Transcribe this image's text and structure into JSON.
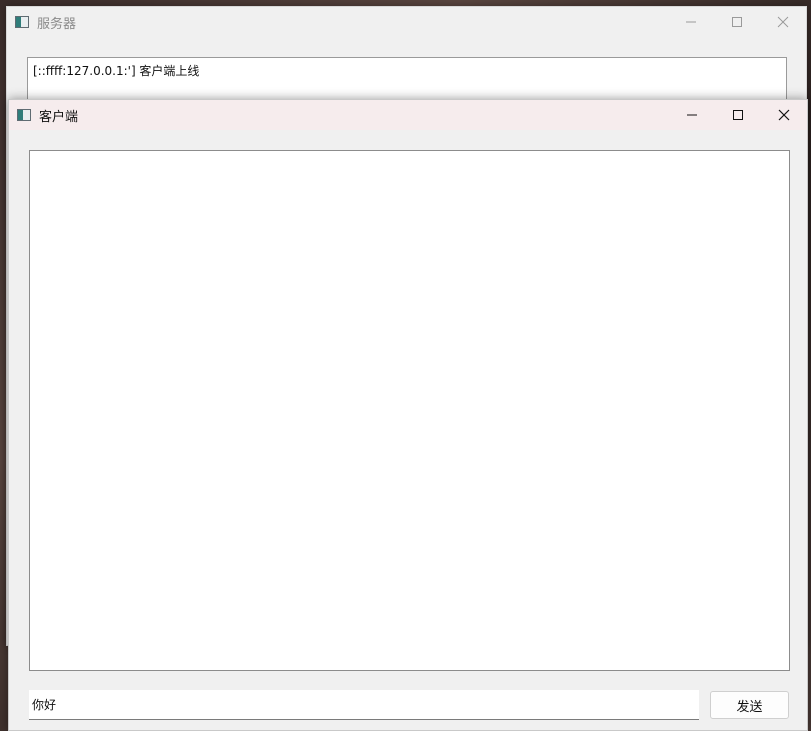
{
  "server_window": {
    "title": "服务器",
    "app_icon": "qt-window-icon",
    "log_text": "[::ffff:127.0.0.1:'] 客户端上线",
    "controls": [
      "minimize-icon",
      "maximize-icon",
      "close-icon"
    ]
  },
  "client_window": {
    "title": "客户端",
    "app_icon": "qt-window-icon",
    "controls": [
      "minimize-icon",
      "maximize-icon",
      "close-icon"
    ],
    "message_input_value": "你好",
    "send_label": "发送"
  }
}
